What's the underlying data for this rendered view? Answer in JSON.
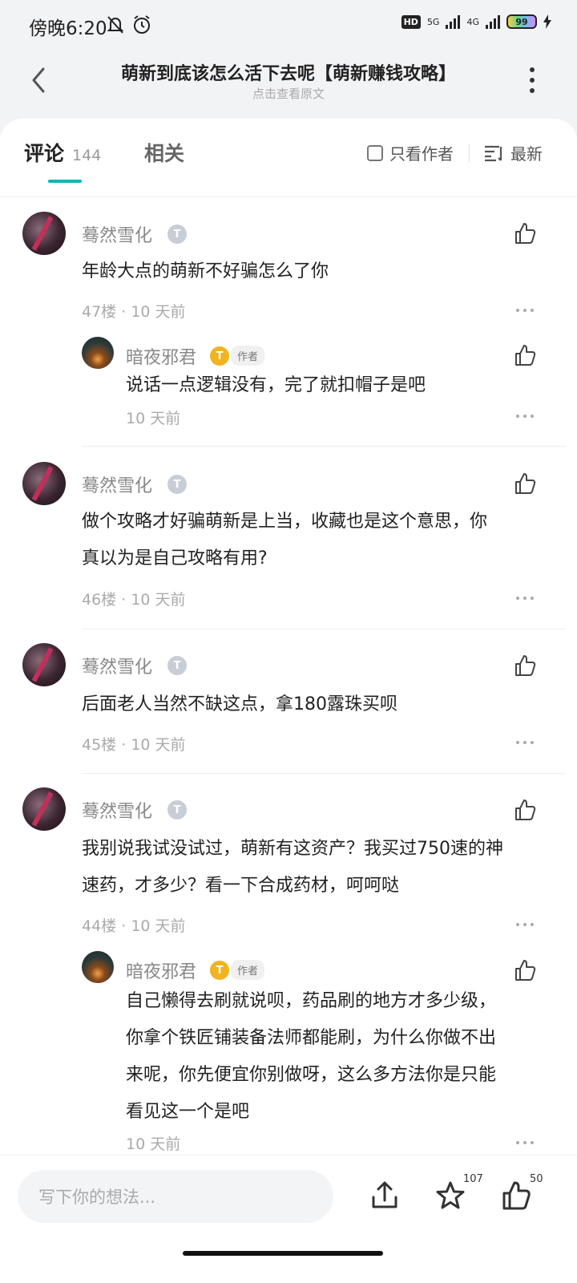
{
  "status": {
    "time": "傍晚6:20",
    "hd": "HD",
    "net1": "5G",
    "net2": "4G",
    "battery": "99"
  },
  "header": {
    "title": "萌新到底该怎么活下去呢【萌新赚钱攻略】",
    "subtitle": "点击查看原文"
  },
  "tabs": {
    "comments_label": "评论",
    "comments_count": "144",
    "related_label": "相关",
    "only_author": "只看作者",
    "sort": "最新"
  },
  "comments": [
    {
      "user": "蓦然雪化",
      "level": "T1",
      "text": "年龄大点的萌新不好骗怎么了你",
      "floor": "47楼",
      "time": "10 天前",
      "replies": [
        {
          "user": "暗夜邪君",
          "level": "T",
          "tag": "作者",
          "text": "说话一点逻辑没有，完了就扣帽子是吧",
          "time": "10 天前"
        }
      ]
    },
    {
      "user": "蓦然雪化",
      "level": "T1",
      "text_lines": [
        "做个攻略才好骗萌新是上当，收藏也是这个意思，你",
        "真以为是自己攻略有用?"
      ],
      "floor": "46楼",
      "time": "10 天前"
    },
    {
      "user": "蓦然雪化",
      "level": "T1",
      "text": "后面老人当然不缺这点，拿180露珠买呗",
      "floor": "45楼",
      "time": "10 天前"
    },
    {
      "user": "蓦然雪化",
      "level": "T1",
      "text_lines": [
        "我别说我试没试过，萌新有这资产？我买过750速的神",
        "速药，才多少？看一下合成药材，呵呵哒"
      ],
      "floor": "44楼",
      "time": "10 天前",
      "replies": [
        {
          "user": "暗夜邪君",
          "level": "T",
          "tag": "作者",
          "text_lines": [
            "自己懒得去刷就说呗，药品刷的地方才多少级，",
            "你拿个铁匠铺装备法师都能刷，为什么你做不出",
            "来呢，你先便宜你别做呀，这么多方法你是只能",
            "看见这一个是吧"
          ],
          "time": "10 天前"
        }
      ]
    }
  ],
  "bottom": {
    "input_placeholder": "写下你的想法...",
    "favorite_count": "107",
    "like_count": "50"
  },
  "colors": {
    "accent": "#17b3b3",
    "gold_badge": "#f2b31f"
  }
}
